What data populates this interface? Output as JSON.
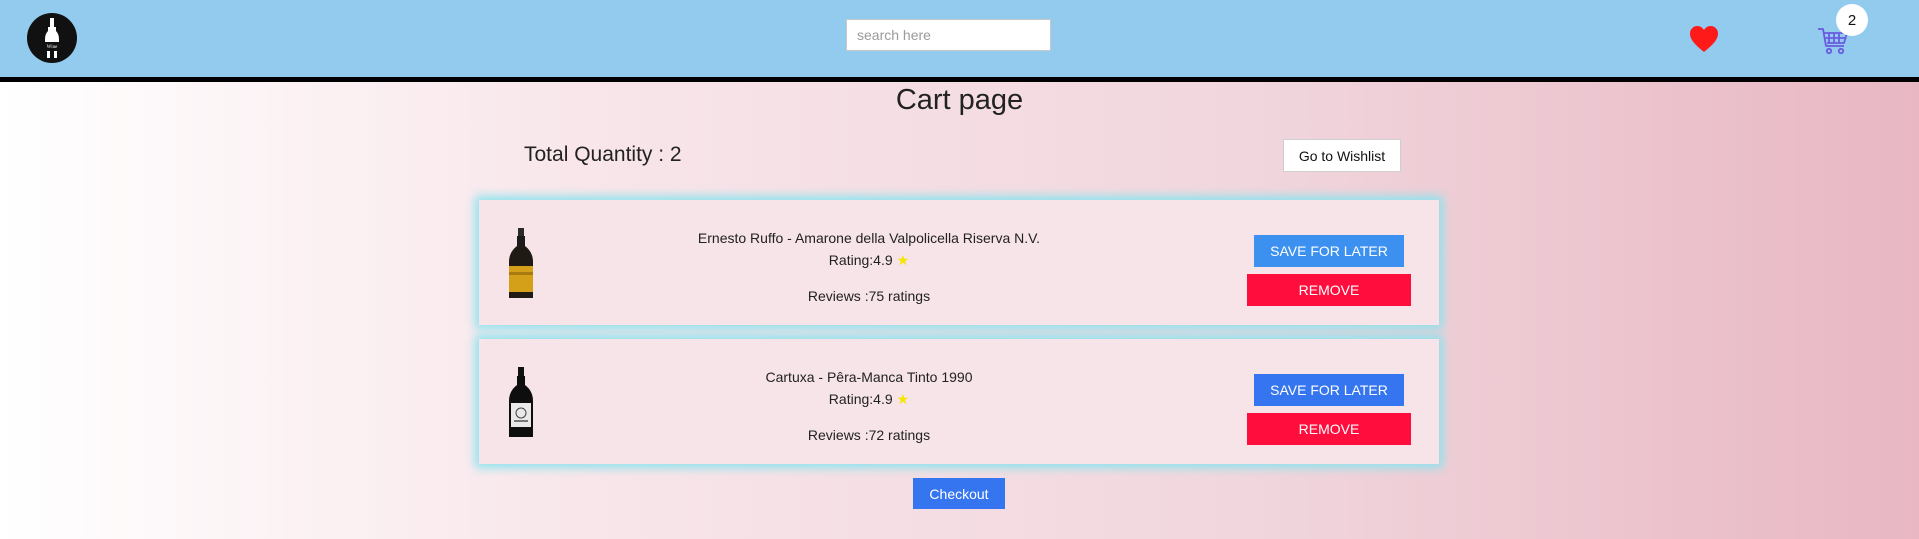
{
  "header": {
    "search": {
      "placeholder": "search here",
      "value": ""
    },
    "cart_count": "2",
    "icons": {
      "logo": "wine-logo",
      "wishlist": "heart-icon",
      "cart": "cart-icon"
    },
    "colors": {
      "navbar": "#92cbee",
      "heart": "#ff1a1a",
      "cart": "#6a5ae0"
    }
  },
  "main": {
    "title": "Cart page",
    "total_quantity": "Total Quantity : 2",
    "wishlist_button": "Go to Wishlist",
    "items": [
      {
        "name": "Ernesto Ruffo  -  Amarone della Valpolicella Riserva N.V.",
        "rating": "Rating:4.9",
        "star": "★",
        "reviews": "Reviews :75 ratings",
        "save_label": "SAVE FOR LATER",
        "remove_label": "REMOVE",
        "save_color": "#3c91f0"
      },
      {
        "name": "Cartuxa  -  Pêra-Manca Tinto 1990",
        "rating": "Rating:4.9",
        "star": "★",
        "reviews": "Reviews :72 ratings",
        "save_label": "SAVE FOR LATER",
        "remove_label": "REMOVE",
        "save_color": "#3575f0"
      }
    ],
    "checkout_label": "Checkout"
  }
}
